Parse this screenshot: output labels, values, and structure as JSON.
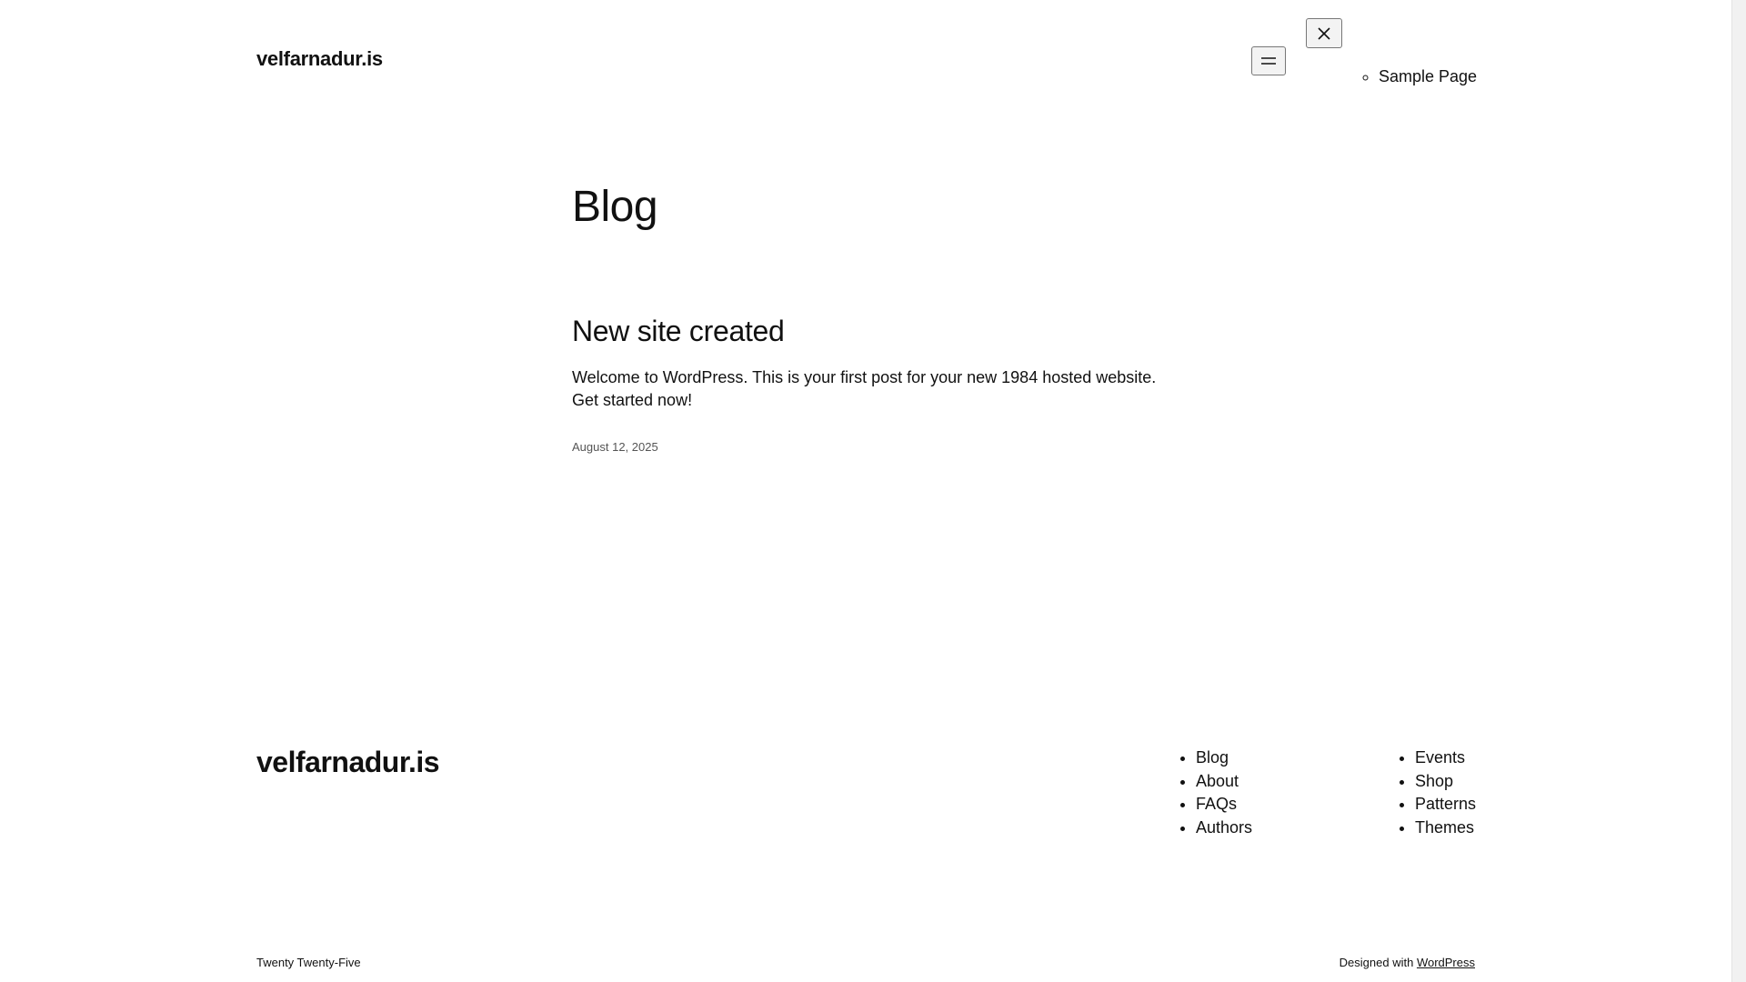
{
  "header": {
    "site_title": "velfarnadur.is",
    "menu_toggle_icon": "hamburger-icon",
    "close_icon": "close-icon",
    "menu_items": [
      "Sample Page"
    ]
  },
  "main": {
    "page_heading": "Blog",
    "post": {
      "title": "New site created",
      "excerpt": "Welcome to WordPress. This is your first post for your new 1984 hosted website. Get started now!",
      "date": "August 12, 2025"
    }
  },
  "footer": {
    "site_title": "velfarnadur.is",
    "menu_col1": [
      "Blog",
      "About",
      "FAQs",
      "Authors"
    ],
    "menu_col2": [
      "Events",
      "Shop",
      "Patterns",
      "Themes"
    ],
    "theme_credit": "Twenty Twenty-Five",
    "designed_with_prefix": "Designed with",
    "designed_with_link": "WordPress"
  }
}
